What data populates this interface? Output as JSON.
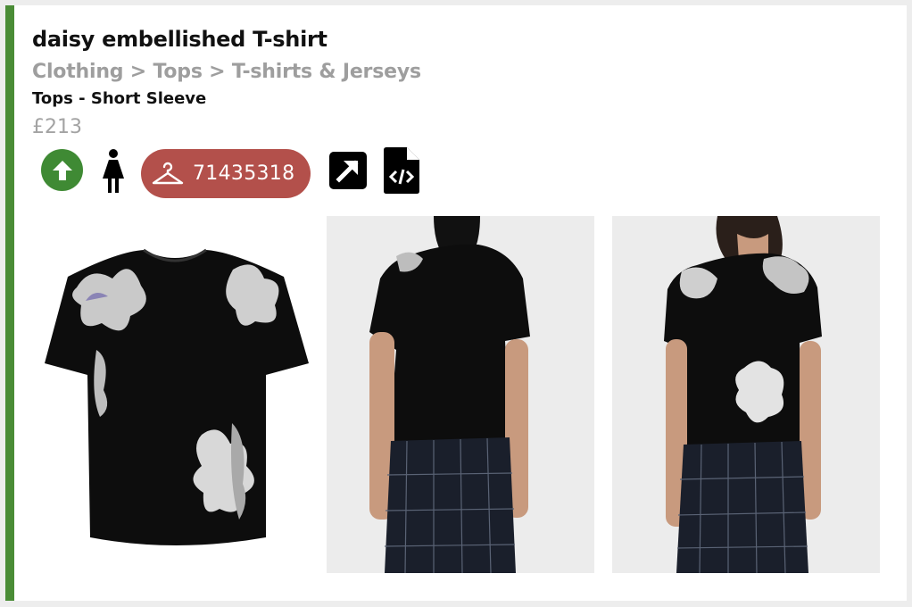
{
  "product": {
    "title": "daisy embellished T-shirt",
    "breadcrumb": "Clothing > Tops > T-shirts & Jerseys",
    "subcategory": "Tops - Short Sleeve",
    "price": "£213",
    "sku": "71435318"
  },
  "actions": {
    "up_icon": "arrow-up-icon",
    "gender_icon": "female-icon",
    "hanger_icon": "hanger-icon",
    "open_icon": "external-link-icon",
    "code_icon": "code-file-icon"
  },
  "colors": {
    "accent_green": "#4a8c36",
    "up_button": "#3f8a34",
    "sku_pill": "#b3504b",
    "muted_text": "#9e9e9e"
  },
  "images": [
    {
      "view": "product-flat"
    },
    {
      "view": "model-back"
    },
    {
      "view": "model-front"
    }
  ]
}
